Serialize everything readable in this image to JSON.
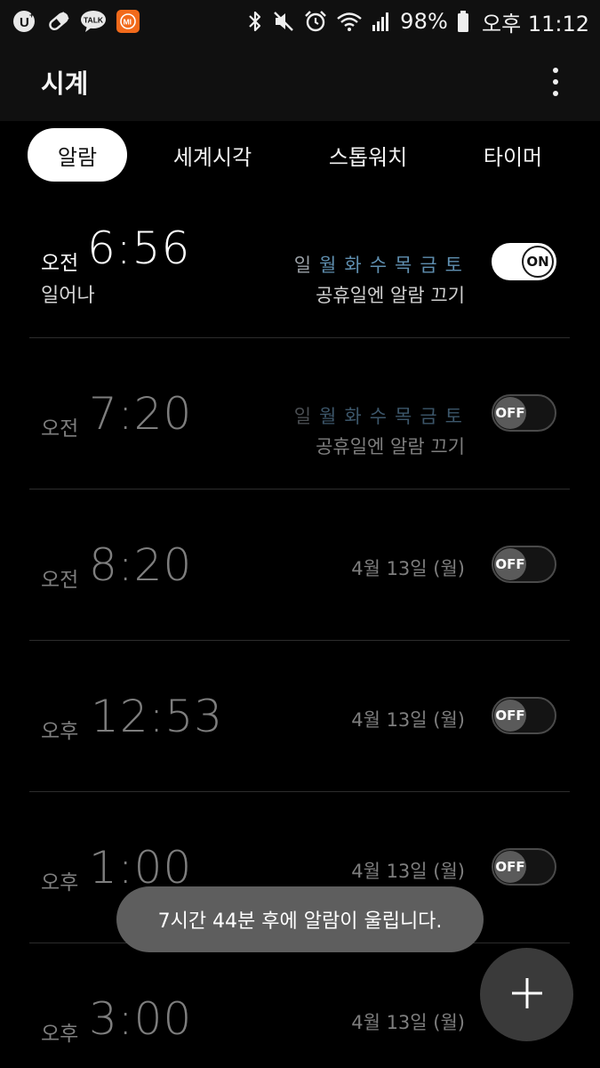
{
  "status_bar": {
    "left_icons": [
      "uplus-icon",
      "pill-icon",
      "kakaotalk-icon",
      "mi-app-icon"
    ],
    "talk_label": "TALK",
    "mi_label": "MI",
    "right_icons": [
      "bluetooth-icon",
      "mute-icon",
      "alarm-icon",
      "wifi-icon",
      "signal-icon",
      "battery-icon"
    ],
    "battery_percent": "98%",
    "time": "오후 11:12",
    "colors": {
      "mi_badge": "#f26a1b"
    }
  },
  "app_bar": {
    "title": "시계",
    "more_icon": "more-vert-icon"
  },
  "tabs": [
    {
      "label": "알람",
      "active": true
    },
    {
      "label": "세계시각",
      "active": false
    },
    {
      "label": "스톱워치",
      "active": false
    },
    {
      "label": "타이머",
      "active": false
    }
  ],
  "alarms": [
    {
      "ampm": "오전",
      "time": "6:56",
      "label": "일어나",
      "days": [
        "일",
        "월",
        "화",
        "수",
        "목",
        "금",
        "토"
      ],
      "holiday_text": "공휴일엔 알람 끄기",
      "toggle": "ON",
      "enabled": true
    },
    {
      "ampm": "오전",
      "time": "7:20",
      "days": [
        "일",
        "월",
        "화",
        "수",
        "목",
        "금",
        "토"
      ],
      "holiday_text": "공휴일엔 알람 끄기",
      "toggle": "OFF",
      "enabled": false
    },
    {
      "ampm": "오전",
      "time": "8:20",
      "date": "4월 13일 (월)",
      "toggle": "OFF",
      "enabled": false
    },
    {
      "ampm": "오후",
      "time": "12:53",
      "date": "4월 13일 (월)",
      "toggle": "OFF",
      "enabled": false
    },
    {
      "ampm": "오후",
      "time": "1:00",
      "date": "4월 13일 (월)",
      "toggle": "OFF",
      "enabled": false
    },
    {
      "ampm": "오후",
      "time": "3:00",
      "date": "4월 13일 (월)",
      "enabled": false
    }
  ],
  "day_colors": {
    "sunday": "#9aa0a6",
    "weekday": "#5f8fb0",
    "sunday_off": "#4a4e52",
    "weekday_off": "#3c566a"
  },
  "toast": {
    "text": "7시간 44분 후에 알람이 울립니다."
  },
  "fab": {
    "icon": "plus-icon"
  }
}
